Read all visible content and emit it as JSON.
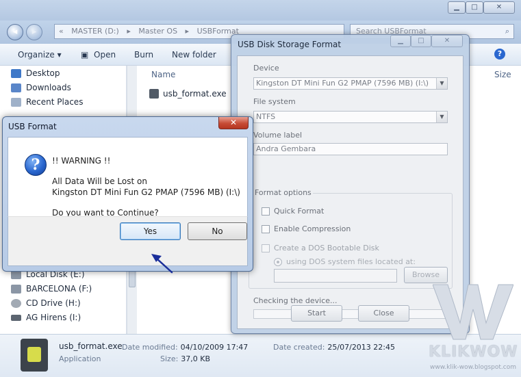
{
  "explorer": {
    "address": [
      "«",
      "MASTER (D:)",
      "▸",
      "Master OS",
      "▸",
      "USBFormat"
    ],
    "search_placeholder": "Search USBFormat",
    "toolbar": {
      "organize": "Organize ▾",
      "open": "Open",
      "burn": "Burn",
      "new_folder": "New folder"
    },
    "columns": {
      "name": "Name",
      "size": "Size"
    },
    "sidebar_top": [
      "Desktop",
      "Downloads",
      "Recent Places"
    ],
    "sidebar_bottom": [
      "Local Disk (E:)",
      "BARCELONA (F:)",
      "CD Drive (H:)",
      "AG Hirens (I:)"
    ],
    "file": "usb_format.exe",
    "details": {
      "name": "usb_format.exe",
      "type": "Application",
      "modified_label": "Date modified:",
      "modified_value": "04/10/2009 17:47",
      "created_label": "Date created:",
      "created_value": "25/07/2013 22:45",
      "size_label": "Size:",
      "size_value": "37,0 KB"
    }
  },
  "usb_window": {
    "title": "USB Disk Storage Format",
    "device_label": "Device",
    "device_value": "Kingston DT Mini Fun G2 PMAP (7596 MB) (I:\\)",
    "fs_label": "File system",
    "fs_value": "NTFS",
    "volume_label": "Volume label",
    "volume_value": "Andra Gembara",
    "format_options": "Format options",
    "quick_format": "Quick Format",
    "enable_compression": "Enable Compression",
    "dos_disk": "Create a DOS Bootable Disk",
    "dos_files": "using DOS system files located at:",
    "browse": "Browse",
    "status": "Checking the device...",
    "start": "Start",
    "close": "Close"
  },
  "modal": {
    "title": "USB Format",
    "close_glyph": "✕",
    "icon_glyph": "?",
    "warning": "!! WARNING !!",
    "line1": "All Data Will be Lost on",
    "line2": "Kingston DT Mini Fun G2 PMAP (7596 MB) (I:\\)",
    "question": "Do you want to Continue?",
    "yes": "Yes",
    "no": "No"
  },
  "watermark": {
    "brand": "KLIKWOW",
    "url": "www.klik-wow.blogspot.com"
  },
  "colors": {
    "accent_blue": "#2a67cf",
    "close_red": "#c64b36",
    "pointer": "#1b2f9a"
  }
}
